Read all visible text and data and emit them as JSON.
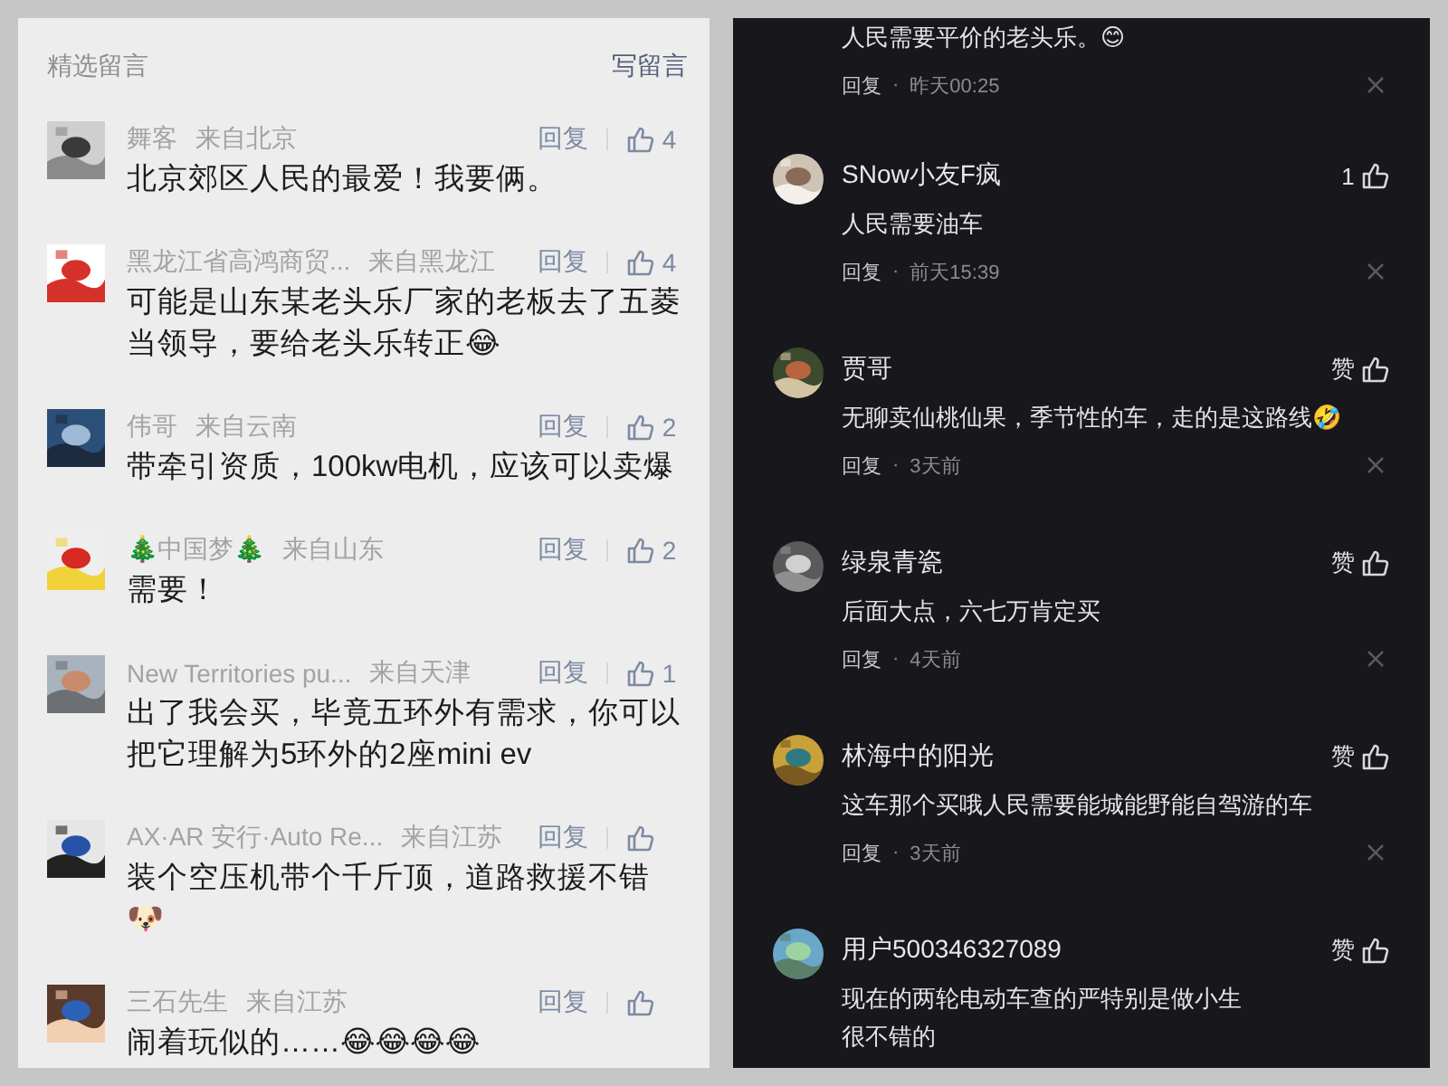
{
  "left_panel": {
    "title": "精选留言",
    "write_button": "写留言",
    "comments": [
      {
        "name": "舞客",
        "location": "来自北京",
        "reply": "回复",
        "likes": "4",
        "text": "北京郊区人民的最爱！我要俩。"
      },
      {
        "name": "黑龙江省高鸿商贸...",
        "location": "来自黑龙江",
        "reply": "回复",
        "likes": "4",
        "text": "可能是山东某老头乐厂家的老板去了五菱当领导，要给老头乐转正😂"
      },
      {
        "name": "伟哥",
        "location": "来自云南",
        "reply": "回复",
        "likes": "2",
        "text": "带牵引资质，100kw电机，应该可以卖爆"
      },
      {
        "name": "🎄中国梦🎄",
        "location": "来自山东",
        "reply": "回复",
        "likes": "2",
        "text": "需要！"
      },
      {
        "name": "New Territories pu...",
        "location": "来自天津",
        "reply": "回复",
        "likes": "1",
        "text": "出了我会买，毕竟五环外有需求，你可以把它理解为5环外的2座mini ev"
      },
      {
        "name": "AX·AR 安行·Auto Re...",
        "location": "来自江苏",
        "reply": "回复",
        "text": "装个空压机带个千斤顶，道路救援不错🐶"
      },
      {
        "name": "三石先生",
        "location": "来自江苏",
        "reply": "回复",
        "text": "闹着玩似的……😂😂😂😂"
      }
    ]
  },
  "right_panel": {
    "comments": [
      {
        "text": "人民需要平价的老头乐。😊",
        "reply": "回复",
        "dot": "·",
        "time": "昨天00:25"
      },
      {
        "name": "SNow小友F疯",
        "likes": "1",
        "text": "人民需要油车",
        "reply": "回复",
        "dot": "·",
        "time": "前天15:39"
      },
      {
        "name": "贾哥",
        "likes": "赞",
        "text": "无聊卖仙桃仙果，季节性的车，走的是这路线🤣",
        "reply": "回复",
        "dot": "·",
        "time": "3天前"
      },
      {
        "name": "绿泉青瓷",
        "likes": "赞",
        "text": "后面大点，六七万肯定买",
        "reply": "回复",
        "dot": "·",
        "time": "4天前"
      },
      {
        "name": "林海中的阳光",
        "likes": "赞",
        "text": "这车那个买哦人民需要能城能野能自驾游的车",
        "reply": "回复",
        "dot": "·",
        "time": "3天前"
      },
      {
        "name": "用户500346327089",
        "likes": "赞",
        "text": [
          "现在的两轮电动车查的严特别是做小生",
          "很不错的"
        ]
      }
    ]
  }
}
